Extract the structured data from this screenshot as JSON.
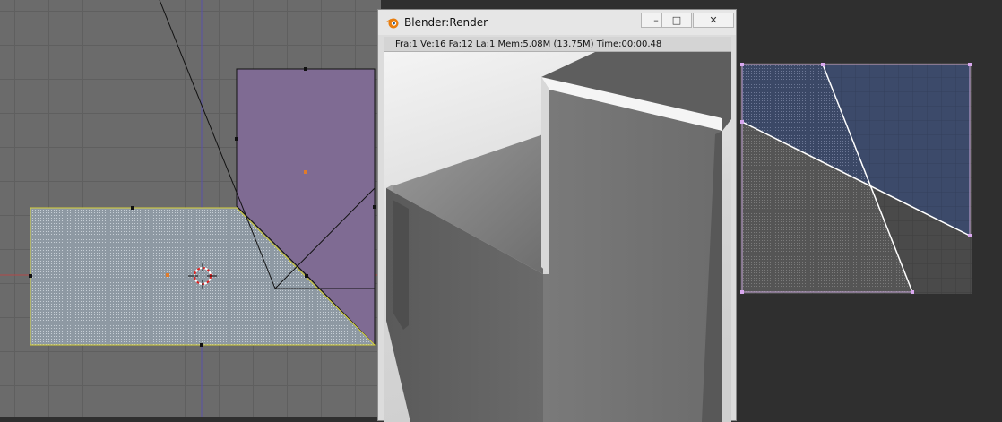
{
  "render_window": {
    "title": "Blender:Render",
    "buttons": {
      "minimize": "–",
      "maximize": "□",
      "close": "✕"
    },
    "status": "Fra:1  Ve:16 Fa:12 La:1  Mem:5.08M (13.75M) Time:00:00.48"
  },
  "icons": {
    "blender_logo": "blender-logo-icon",
    "cursor_3d": "3d-cursor-icon"
  },
  "colors": {
    "viewport_bg": "#6b6b6b",
    "selected_face": "#7f6b93",
    "mesh_face": "#9aa5b0",
    "uv_bg": "#3a3a3a",
    "uv_face_blue": "#3c4a6a",
    "uv_face_grey": "#5e5e5e",
    "accent_orange": "#e07b2a"
  }
}
